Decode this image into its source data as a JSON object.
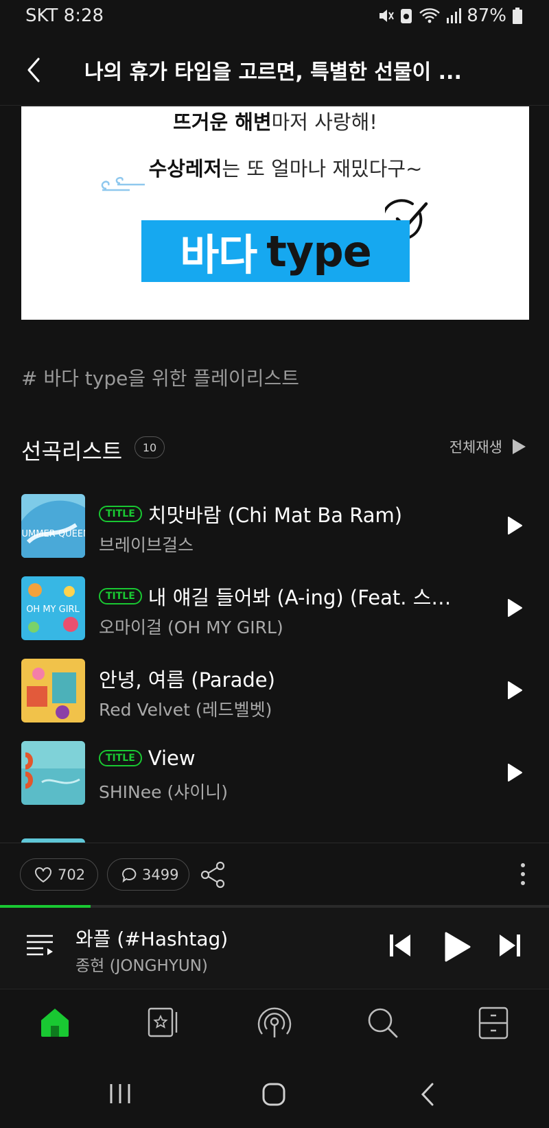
{
  "status_bar": {
    "carrier_time": "SKT 8:28",
    "battery": "87%",
    "icons": [
      "mute-icon",
      "battery-saver-icon",
      "wifi-icon",
      "signal-icon",
      "battery-icon"
    ]
  },
  "header": {
    "title": "나의 휴가 타입을 고르면, 특별한 선물이 ...",
    "back_icon": "chevron-left-icon"
  },
  "banner": {
    "line1_bold": "뜨거운 해변",
    "line1_rest": "마저 사랑해!",
    "line2_bold": "수상레저",
    "line2_rest": "는 또 얼마나 재밌다구~",
    "type_kr": "바다",
    "type_en": "type"
  },
  "hashtag": "# 바다 type을 위한 플레이리스트",
  "playlist": {
    "title": "선곡리스트",
    "count": "10",
    "play_all": "전체재생"
  },
  "tracks": [
    {
      "badge": "TITLE",
      "name": "치맛바람 (Chi Mat Ba Ram)",
      "artist": "브레이브걸스",
      "cover_text": "SUMMER QUEEN"
    },
    {
      "badge": "TITLE",
      "name": "내 얘길 들어봐 (A-ing) (Feat. 스컬&...",
      "artist": "오마이걸 (OH MY GIRL)",
      "cover_text": "OH MY GIRL"
    },
    {
      "badge": "",
      "name": "안녕, 여름 (Parade)",
      "artist": "Red Velvet (레드벨벳)",
      "cover_text": ""
    },
    {
      "badge": "TITLE",
      "name": "View",
      "artist": "SHINee (샤이니)",
      "cover_text": ""
    }
  ],
  "social": {
    "likes": "702",
    "comments": "3499"
  },
  "now_playing": {
    "title": "와플 (#Hashtag)",
    "artist": "종현 (JONGHYUN)",
    "progress": 0.165
  },
  "bottom_nav": [
    "home-icon",
    "my-music-icon",
    "podcast-icon",
    "search-icon",
    "library-icon"
  ],
  "colors": {
    "accent": "#19c832",
    "background": "#131313",
    "banner_blue": "#16a8f0"
  }
}
